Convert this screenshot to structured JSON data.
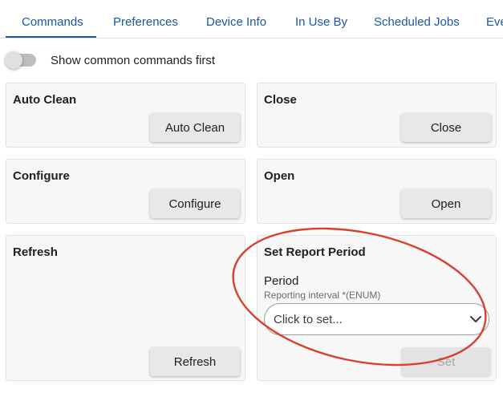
{
  "tabs": [
    {
      "label": "Commands",
      "active": true
    },
    {
      "label": "Preferences"
    },
    {
      "label": "Device Info"
    },
    {
      "label": "In Use By"
    },
    {
      "label": "Scheduled Jobs"
    },
    {
      "label": "Eve"
    }
  ],
  "toggle": {
    "label": "Show common commands first",
    "on": false
  },
  "commands": {
    "auto_clean": {
      "title": "Auto Clean",
      "button": "Auto Clean"
    },
    "close": {
      "title": "Close",
      "button": "Close"
    },
    "configure": {
      "title": "Configure",
      "button": "Configure"
    },
    "open": {
      "title": "Open",
      "button": "Open"
    },
    "refresh": {
      "title": "Refresh",
      "button": "Refresh"
    },
    "set_report_period": {
      "title": "Set Report Period",
      "field_label": "Period",
      "field_hint": "Reporting interval *(ENUM)",
      "select_value": "Click to set...",
      "button": "Set",
      "button_disabled": true
    }
  },
  "colors": {
    "accent": "#1a57a6",
    "card_bg": "#f7f7f7",
    "annotation_stroke": "#d9402b"
  },
  "icons": {
    "select_arrow": "chevron-down-icon"
  }
}
